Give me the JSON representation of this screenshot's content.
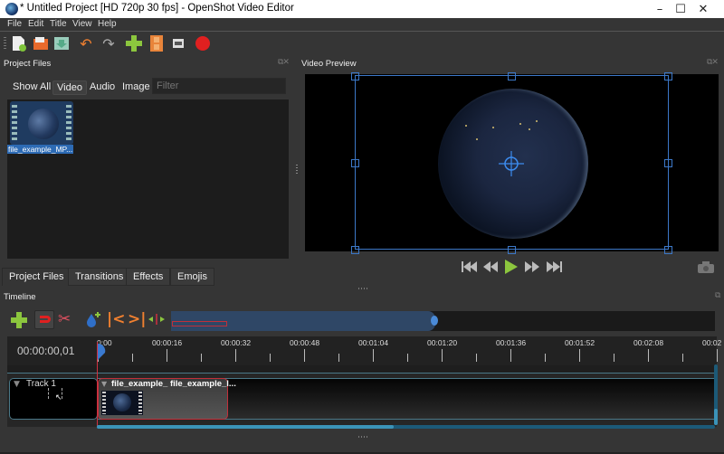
{
  "window": {
    "title": "* Untitled Project [HD 720p 30 fps] - OpenShot Video Editor",
    "controls": {
      "minimize": "–",
      "maximize": "☐",
      "close": "✕"
    }
  },
  "menu": [
    "File",
    "Edit",
    "Title",
    "View",
    "Help"
  ],
  "toolbar": {
    "icons": [
      "new-project-icon",
      "open-project-icon",
      "save-project-icon",
      "undo-icon",
      "redo-icon",
      "import-files-icon",
      "profile-icon",
      "fullscreen-icon",
      "export-video-icon"
    ]
  },
  "project_files": {
    "title": "Project Files",
    "filters": [
      "Show All",
      "Video",
      "Audio",
      "Image"
    ],
    "active_filter": "Video",
    "filter_placeholder": "Filter",
    "files": [
      {
        "name": "file_example_MP..."
      }
    ]
  },
  "bottom_tabs": [
    "Project Files",
    "Transitions",
    "Effects",
    "Emojis"
  ],
  "active_tab": "Project Files",
  "video_preview": {
    "title": "Video Preview",
    "controls": [
      "jump-start",
      "rewind",
      "play",
      "fast-forward",
      "jump-end"
    ]
  },
  "timeline": {
    "title": "Timeline",
    "current_time": "00:00:00,01",
    "zoom_visible_fraction": 0.49,
    "ruler_labels": [
      "0:00",
      "00:00:16",
      "00:00:32",
      "00:00:48",
      "00:01:04",
      "00:01:20",
      "00:01:36",
      "00:01:52",
      "00:02:08",
      "00:02"
    ],
    "tracks": [
      {
        "name": "Track 1"
      }
    ],
    "clips": [
      {
        "title": "file_example_ file_example_l..."
      }
    ]
  },
  "colors": {
    "accent": "#3c78c8",
    "playhead": "#d03040",
    "track_border": "#4a7888",
    "play_green": "#8cc63e"
  }
}
